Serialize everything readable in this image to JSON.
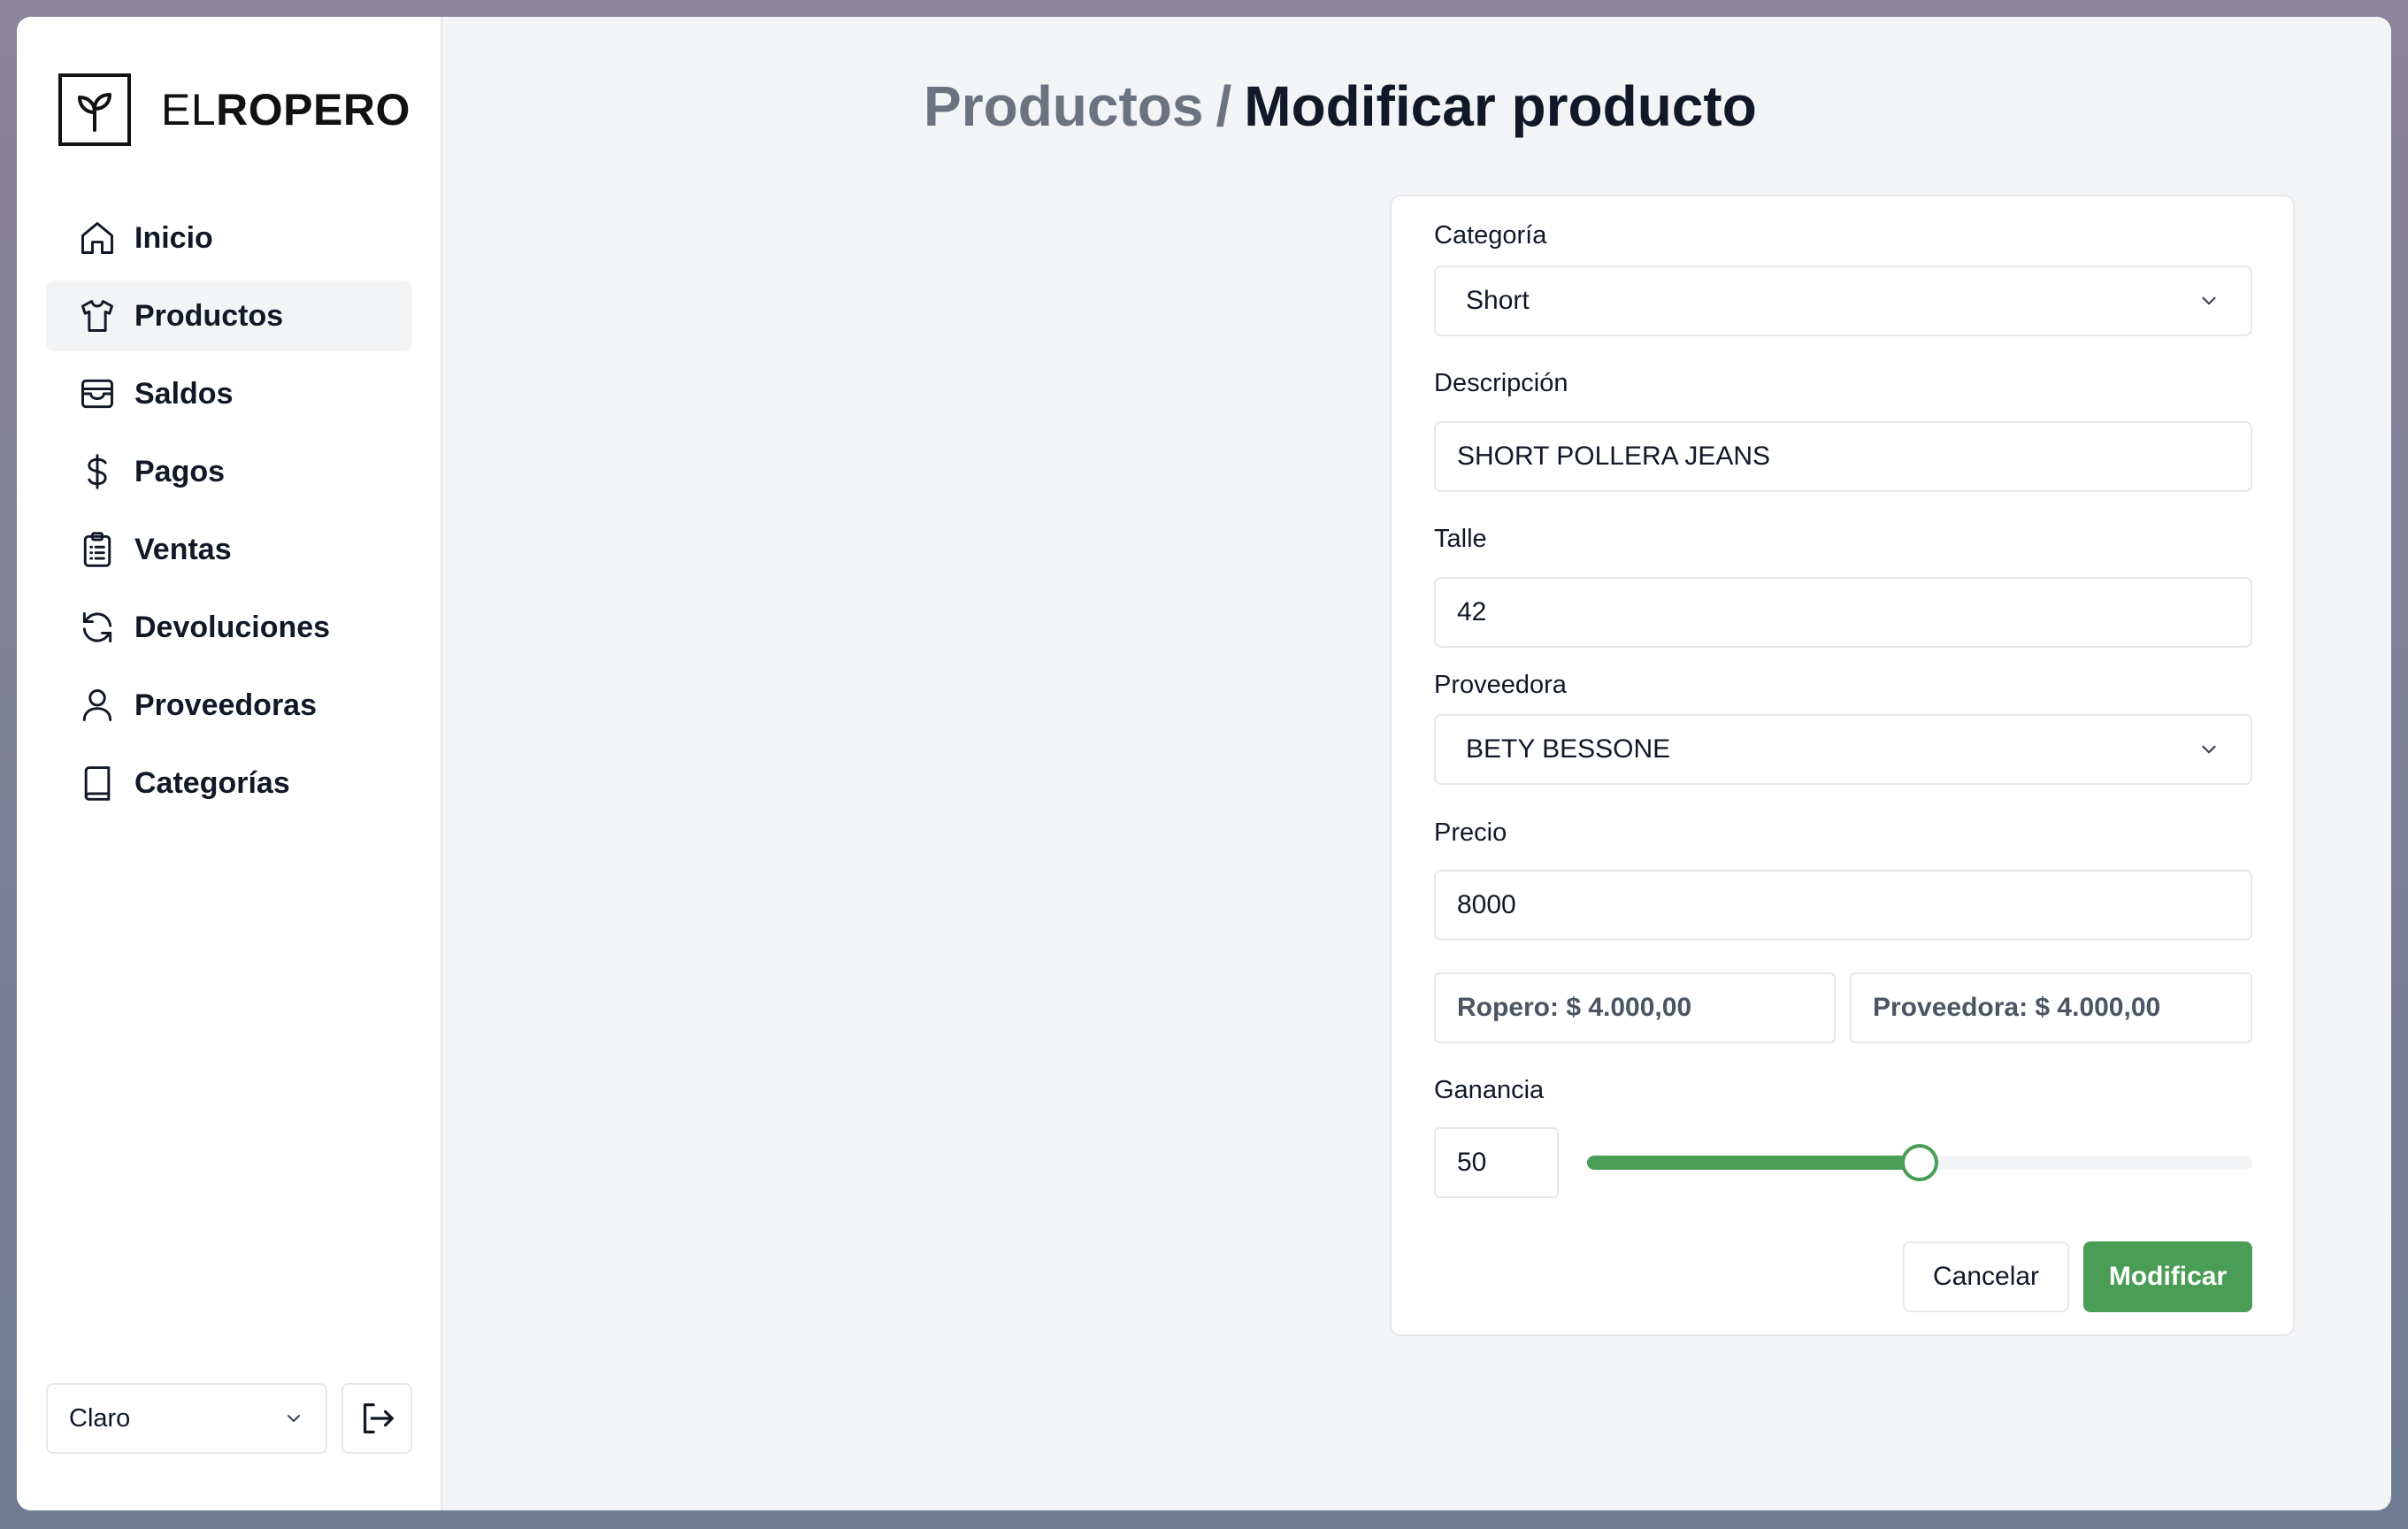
{
  "brand": {
    "prefix": "EL",
    "name": "ROPERO"
  },
  "sidebar": {
    "items": [
      {
        "label": "Inicio",
        "icon": "home-icon"
      },
      {
        "label": "Productos",
        "icon": "shirt-icon",
        "active": true
      },
      {
        "label": "Saldos",
        "icon": "wallet-icon"
      },
      {
        "label": "Pagos",
        "icon": "dollar-icon"
      },
      {
        "label": "Ventas",
        "icon": "clipboard-list-icon"
      },
      {
        "label": "Devoluciones",
        "icon": "refresh-icon"
      },
      {
        "label": "Proveedoras",
        "icon": "user-icon"
      },
      {
        "label": "Categorías",
        "icon": "book-icon"
      }
    ],
    "theme": {
      "value": "Claro"
    }
  },
  "breadcrumb": {
    "parent": "Productos",
    "separator": "/",
    "current": "Modificar producto"
  },
  "form": {
    "categoria": {
      "label": "Categoría",
      "value": "Short"
    },
    "descripcion": {
      "label": "Descripción",
      "value": "SHORT POLLERA JEANS"
    },
    "talle": {
      "label": "Talle",
      "value": "42"
    },
    "proveedora": {
      "label": "Proveedora",
      "value": "BETY BESSONE"
    },
    "precio": {
      "label": "Precio",
      "value": "8000",
      "ropero_share": "Ropero: $ 4.000,00",
      "proveedora_share": "Proveedora: $ 4.000,00"
    },
    "ganancia": {
      "label": "Ganancia",
      "value": "50",
      "slider_percent": 50
    },
    "buttons": {
      "cancel": "Cancelar",
      "submit": "Modificar"
    }
  },
  "colors": {
    "accent": "#4a9d54",
    "background": "#f3f4f6",
    "border": "#e5e7eb"
  }
}
